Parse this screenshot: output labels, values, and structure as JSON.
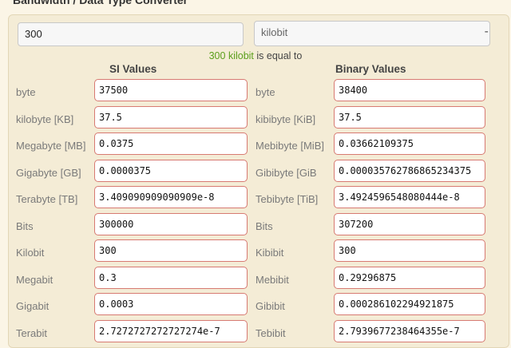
{
  "title": "Bandwidth / Data Type Converter",
  "input": {
    "value": "300"
  },
  "unit_select": {
    "selected": "kilobit"
  },
  "equal": {
    "prefix": "300 kilobit",
    "suffix": " is equal to"
  },
  "headers": {
    "si": "SI Values",
    "binary": "Binary Values"
  },
  "si_rows": [
    {
      "label": "byte",
      "value": "37500"
    },
    {
      "label": "kilobyte [KB]",
      "value": "37.5"
    },
    {
      "label": "Megabyte [MB]",
      "value": "0.0375"
    },
    {
      "label": "Gigabyte [GB]",
      "value": "0.0000375"
    },
    {
      "label": "Terabyte [TB]",
      "value": "3.409090909090909e-8"
    },
    {
      "label": "Bits",
      "value": "300000"
    },
    {
      "label": "Kilobit",
      "value": "300"
    },
    {
      "label": "Megabit",
      "value": "0.3"
    },
    {
      "label": "Gigabit",
      "value": "0.0003"
    },
    {
      "label": "Terabit",
      "value": "2.7272727272727274e-7"
    }
  ],
  "binary_rows": [
    {
      "label": "byte",
      "value": "38400"
    },
    {
      "label": "kibibyte [KiB]",
      "value": "37.5"
    },
    {
      "label": "Mebibyte [MiB]",
      "value": "0.03662109375"
    },
    {
      "label": "Gibibyte [GiB",
      "value": "0.000035762786865234375"
    },
    {
      "label": "Tebibyte [TiB]",
      "value": "3.4924596548080444e-8"
    },
    {
      "label": "Bits",
      "value": "307200"
    },
    {
      "label": "Kibibit",
      "value": "300"
    },
    {
      "label": "Mebibit",
      "value": "0.29296875"
    },
    {
      "label": "Gibibit",
      "value": "0.000286102294921875"
    },
    {
      "label": "Tebibit",
      "value": "2.7939677238464355e-7"
    }
  ]
}
